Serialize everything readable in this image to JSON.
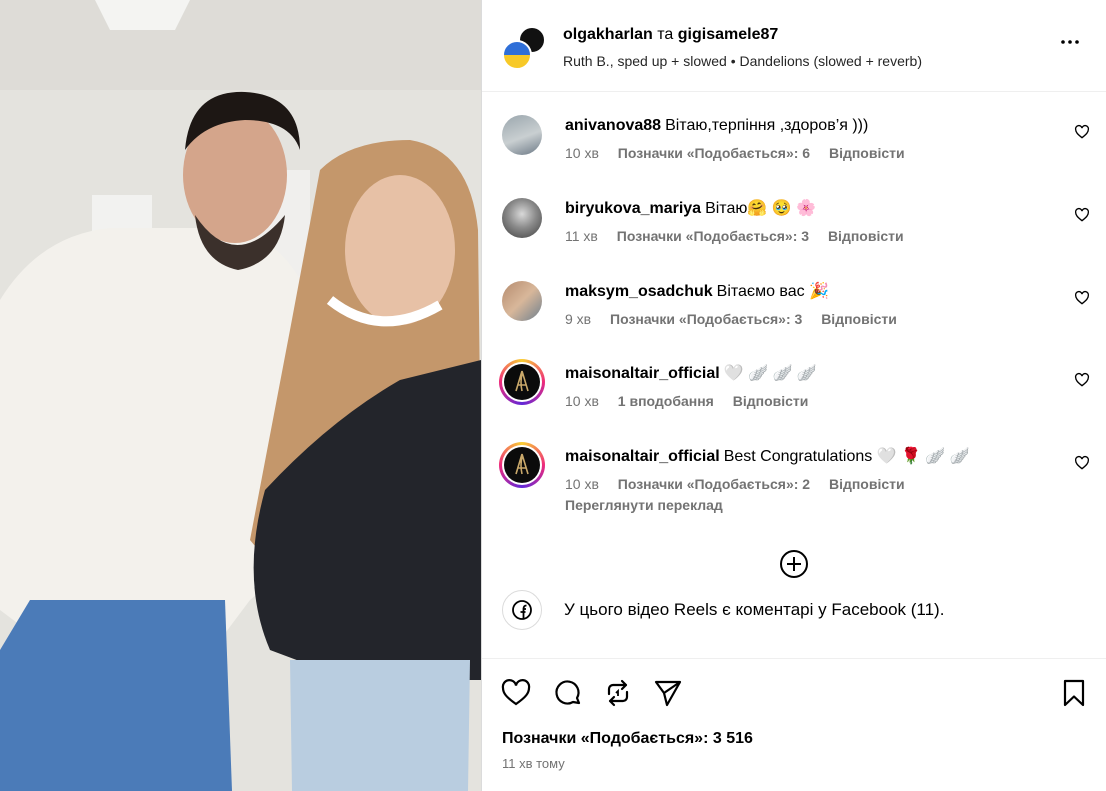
{
  "header": {
    "user1": "olgakharlan",
    "joiner": "та",
    "user2": "gigisamele87",
    "music": "Ruth B., sped up + slowed • Dandelions (slowed + reverb)"
  },
  "comments": [
    {
      "user": "anivanova88",
      "text": "Вітаю,терпіння ,здоров’я )))",
      "time": "10 хв",
      "likes": "Позначки «Подобається»: 6",
      "reply": "Відповісти"
    },
    {
      "user": "biryukova_mariya",
      "text": "Вітаю🤗 🥹 🌸",
      "time": "11 хв",
      "likes": "Позначки «Подобається»: 3",
      "reply": "Відповісти"
    },
    {
      "user": "maksym_osadchuk",
      "text": "Вітаємо вас 🎉",
      "time": "9 хв",
      "likes": "Позначки «Подобається»: 3",
      "reply": "Відповісти"
    },
    {
      "user": "maisonaltair_official",
      "text": "🤍 🪽 🪽 🪽",
      "time": "10 хв",
      "likes": "1 вподобання",
      "reply": "Відповісти"
    },
    {
      "user": "maisonaltair_official",
      "text": "Best Congratulations 🤍 🌹 🪽 🪽",
      "time": "10 хв",
      "likes": "Позначки «Подобається»: 2",
      "reply": "Відповісти",
      "extra": "Переглянути переклад"
    }
  ],
  "facebook_note": "У цього відео Reels є коментарі у Facebook (11).",
  "footer": {
    "likes": "Позначки «Подобається»: 3 516",
    "time": "11 хв тому"
  },
  "icons": [
    "more-icon",
    "heart-icon",
    "comment-icon",
    "repost-icon",
    "share-icon",
    "bookmark-icon",
    "plus-circle-icon",
    "facebook-icon"
  ]
}
